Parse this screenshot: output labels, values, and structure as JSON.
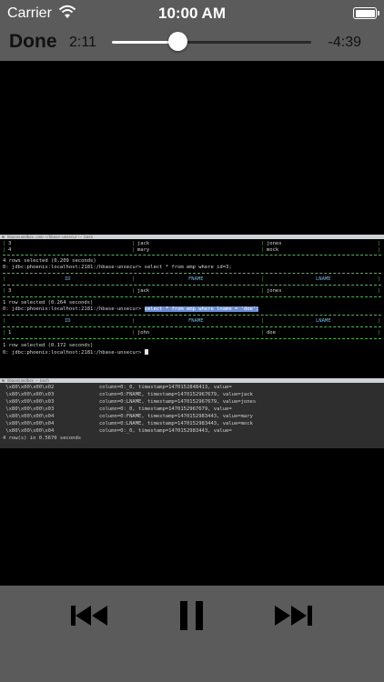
{
  "status_bar": {
    "carrier": "Carrier",
    "time": "10:00 AM"
  },
  "player": {
    "done_label": "Done",
    "elapsed": "2:11",
    "remaining": "-4:39",
    "progress": 0.33
  },
  "terminal1": {
    "title": "hbasesandbox.com:~/hbase-unsecur:~ bash",
    "row_top": {
      "id": "3",
      "fname": "jack",
      "lname": "jones"
    },
    "row_top2": {
      "id": "4",
      "fname": "mary",
      "lname": "mock"
    },
    "rows_selected_1": "4 rows selected (0.209 seconds)",
    "prompt1": "0: jdbc:phoenix:localhost:2181:/hbase-unsecur> select * from emp where id=3;",
    "headers": {
      "id": "ID",
      "fname": "FNAME",
      "lname": "LNAME"
    },
    "result1": {
      "id": "3",
      "fname": "jack",
      "lname": "jones"
    },
    "rows_selected_2": "1 row selected (0.264 seconds)",
    "prompt2": "0: jdbc:phoenix:localhost:2181:/hbase-unsecur>",
    "query2": "select * from emp where lname = 'doe';",
    "result2": {
      "id": "1",
      "fname": "john",
      "lname": "doe"
    },
    "rows_selected_3": "1 row selected (0.172 seconds)",
    "prompt3": "0: jdbc:phoenix:localhost:2181:/hbase-unsecur>"
  },
  "terminal2": {
    "title": "hbasesandbox — bash",
    "lines": [
      " \\x80\\x00\\x00\\x02               column=0:_0, timestamp=1470152848413, value=",
      " \\x80\\x00\\x00\\x03               column=0:FNAME, timestamp=1470152967679, value=jack",
      " \\x80\\x00\\x00\\x03               column=0:LNAME, timestamp=1470152967679, value=jones",
      " \\x80\\x00\\x00\\x03               column=0:_0, timestamp=1470152967679, value=",
      " \\x80\\x00\\x00\\x04               column=0:FNAME, timestamp=1470152983443, value=mary",
      " \\x80\\x00\\x00\\x04               column=0:LNAME, timestamp=1470152983443, value=mock",
      " \\x80\\x00\\x00\\x04               column=0:_0, timestamp=1470152983443, value=",
      "4 row(s) in 0.5670 seconds"
    ]
  },
  "controls": {
    "previous_icon": "skip-previous-icon",
    "pause_icon": "pause-icon",
    "next_icon": "skip-next-icon"
  },
  "colors": {
    "bar_gray": "#5b5b5b",
    "terminal_dash": "#5aaf5a",
    "header_text": "#6fb6e8",
    "selection": "#6b8fd6"
  }
}
